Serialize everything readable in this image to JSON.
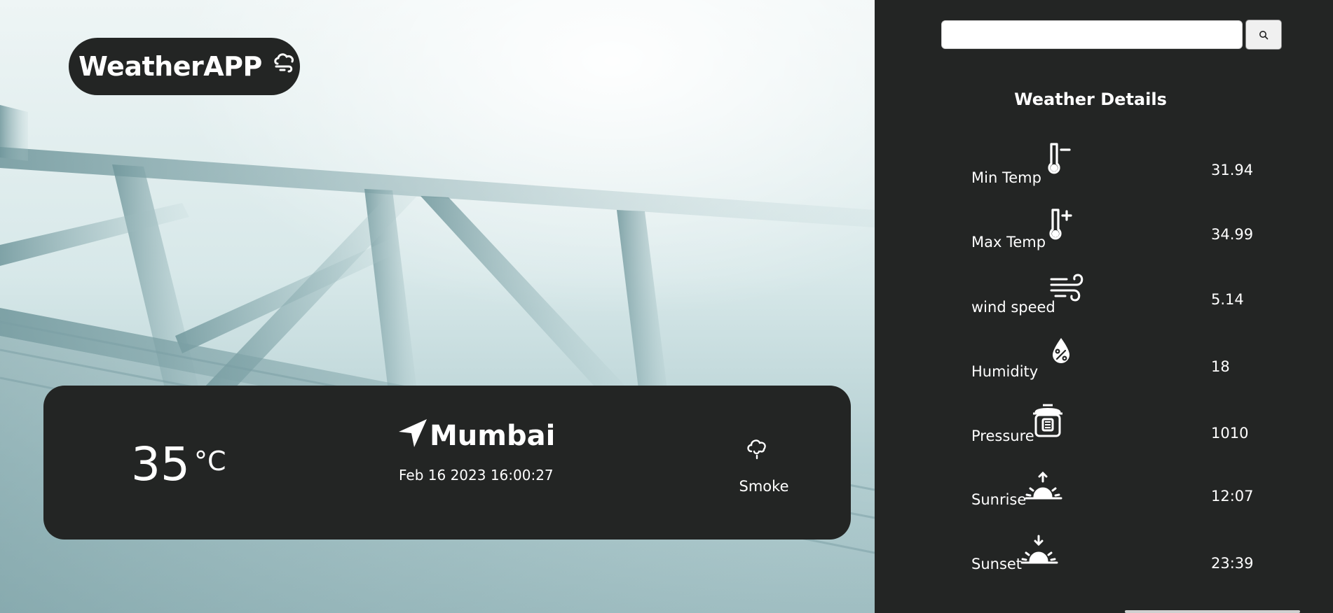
{
  "app": {
    "title": "WeatherAPP",
    "brand_icon": "cloud-wind-icon"
  },
  "current": {
    "temperature": "35",
    "unit": "°C",
    "location_icon": "navigation-arrow-icon",
    "city": "Mumbai",
    "datetime": "Feb 16 2023 16:00:27",
    "condition_icon": "smoke-cloud-icon",
    "condition": "Smoke"
  },
  "search": {
    "value": "",
    "placeholder": "",
    "button_icon": "search-icon"
  },
  "details": {
    "title": "Weather Details",
    "items": [
      {
        "label": "Min Temp",
        "value": "31.94",
        "icon": "thermometer-minus-icon"
      },
      {
        "label": "Max Temp",
        "value": "34.99",
        "icon": "thermometer-plus-icon"
      },
      {
        "label": "wind speed",
        "value": "5.14",
        "icon": "wind-icon"
      },
      {
        "label": "Humidity",
        "value": "18",
        "icon": "humidity-drop-icon"
      },
      {
        "label": "Pressure",
        "value": "1010",
        "icon": "pressure-cooker-icon"
      },
      {
        "label": "Sunrise",
        "value": "12:07",
        "icon": "sunrise-icon"
      },
      {
        "label": "Sunset",
        "value": "23:39",
        "icon": "sunset-icon"
      }
    ]
  },
  "colors": {
    "panel": "#232524",
    "text": "#ffffff",
    "fog": "#d7e8e9"
  }
}
